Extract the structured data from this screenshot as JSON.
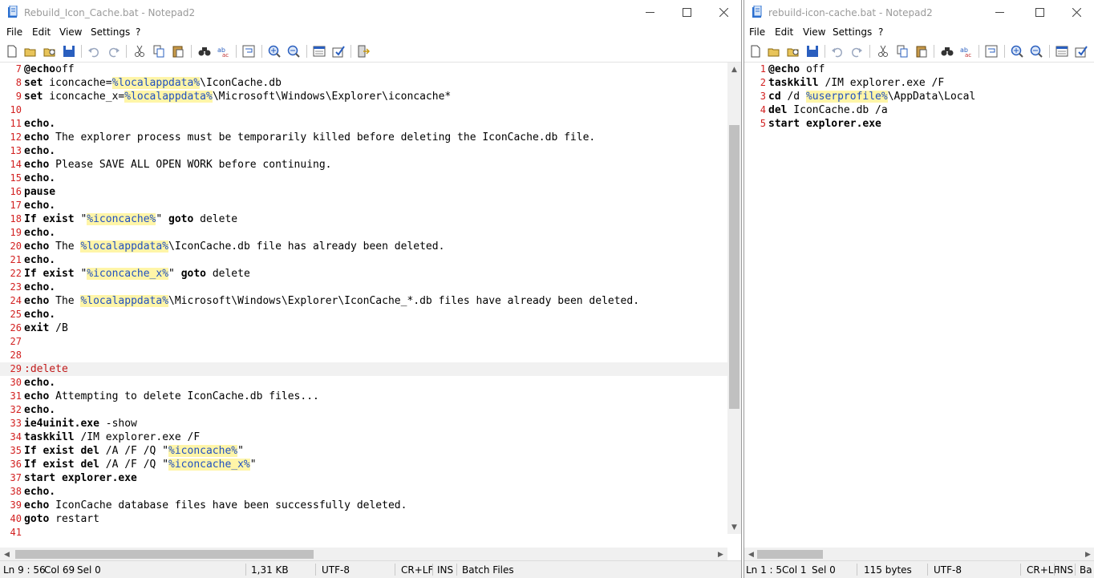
{
  "left": {
    "title": "Rebuild_Icon_Cache.bat - Notepad2",
    "menu": [
      "File",
      "Edit",
      "View",
      "Settings",
      "?"
    ],
    "lines": [
      {
        "n": "7",
        "seg": [
          [
            "kw",
            "@echo"
          ],
          [
            "",
            "off"
          ]
        ]
      },
      {
        "n": "8",
        "seg": [
          [
            "kw",
            "set"
          ],
          [
            "",
            " iconcache="
          ],
          [
            "var",
            "%localappdata%"
          ],
          [
            "",
            "\\IconCache.db"
          ]
        ]
      },
      {
        "n": "9",
        "seg": [
          [
            "kw",
            "set"
          ],
          [
            "",
            " iconcache_x="
          ],
          [
            "var",
            "%localappdata%"
          ],
          [
            "",
            "\\Microsoft\\Windows\\Explorer\\iconcache*"
          ]
        ]
      },
      {
        "n": "10",
        "seg": []
      },
      {
        "n": "11",
        "seg": [
          [
            "kw",
            "echo."
          ]
        ]
      },
      {
        "n": "12",
        "seg": [
          [
            "kw",
            "echo"
          ],
          [
            "",
            " The explorer process must be temporarily killed before deleting the IconCache.db file."
          ]
        ]
      },
      {
        "n": "13",
        "seg": [
          [
            "kw",
            "echo."
          ]
        ]
      },
      {
        "n": "14",
        "seg": [
          [
            "kw",
            "echo"
          ],
          [
            "",
            " Please SAVE ALL OPEN WORK before continuing."
          ]
        ]
      },
      {
        "n": "15",
        "seg": [
          [
            "kw",
            "echo."
          ]
        ]
      },
      {
        "n": "16",
        "seg": [
          [
            "kw",
            "pause"
          ]
        ]
      },
      {
        "n": "17",
        "seg": [
          [
            "kw",
            "echo."
          ]
        ]
      },
      {
        "n": "18",
        "seg": [
          [
            "kw",
            "If exist"
          ],
          [
            "",
            " \""
          ],
          [
            "var",
            "%iconcache%"
          ],
          [
            "",
            "\" "
          ],
          [
            "kw",
            "goto"
          ],
          [
            "",
            " delete"
          ]
        ]
      },
      {
        "n": "19",
        "seg": [
          [
            "kw",
            "echo."
          ]
        ]
      },
      {
        "n": "20",
        "seg": [
          [
            "kw",
            "echo"
          ],
          [
            "",
            " The "
          ],
          [
            "var",
            "%localappdata%"
          ],
          [
            "",
            "\\IconCache.db file has already been deleted."
          ]
        ]
      },
      {
        "n": "21",
        "seg": [
          [
            "kw",
            "echo."
          ]
        ]
      },
      {
        "n": "22",
        "seg": [
          [
            "kw",
            "If exist"
          ],
          [
            "",
            " \""
          ],
          [
            "var",
            "%iconcache_x%"
          ],
          [
            "",
            "\" "
          ],
          [
            "kw",
            "goto"
          ],
          [
            "",
            " delete"
          ]
        ]
      },
      {
        "n": "23",
        "seg": [
          [
            "kw",
            "echo."
          ]
        ]
      },
      {
        "n": "24",
        "seg": [
          [
            "kw",
            "echo"
          ],
          [
            "",
            " The "
          ],
          [
            "var",
            "%localappdata%"
          ],
          [
            "",
            "\\Microsoft\\Windows\\Explorer\\IconCache_*.db files have already been deleted."
          ]
        ]
      },
      {
        "n": "25",
        "seg": [
          [
            "kw",
            "echo."
          ]
        ]
      },
      {
        "n": "26",
        "seg": [
          [
            "kw",
            "exit"
          ],
          [
            "",
            " /B"
          ]
        ]
      },
      {
        "n": "27",
        "seg": []
      },
      {
        "n": "28",
        "seg": []
      },
      {
        "n": "29",
        "seg": [
          [
            "label",
            ":delete"
          ]
        ],
        "current": true
      },
      {
        "n": "30",
        "seg": [
          [
            "kw",
            "echo."
          ]
        ]
      },
      {
        "n": "31",
        "seg": [
          [
            "kw",
            "echo"
          ],
          [
            "",
            " Attempting to delete IconCache.db files..."
          ]
        ]
      },
      {
        "n": "32",
        "seg": [
          [
            "kw",
            "echo."
          ]
        ]
      },
      {
        "n": "33",
        "seg": [
          [
            "kw",
            "ie4uinit.exe"
          ],
          [
            "",
            " -show"
          ]
        ]
      },
      {
        "n": "34",
        "seg": [
          [
            "kw",
            "taskkill"
          ],
          [
            "",
            " /IM explorer.exe /F"
          ]
        ]
      },
      {
        "n": "35",
        "seg": [
          [
            "kw",
            "If exist del"
          ],
          [
            "",
            " /A /F /Q \""
          ],
          [
            "var",
            "%iconcache%"
          ],
          [
            "",
            "\""
          ]
        ]
      },
      {
        "n": "36",
        "seg": [
          [
            "kw",
            "If exist del"
          ],
          [
            "",
            " /A /F /Q \""
          ],
          [
            "var",
            "%iconcache_x%"
          ],
          [
            "",
            "\""
          ]
        ]
      },
      {
        "n": "37",
        "seg": [
          [
            "kw",
            "start explorer.exe"
          ]
        ]
      },
      {
        "n": "38",
        "seg": [
          [
            "kw",
            "echo."
          ]
        ]
      },
      {
        "n": "39",
        "seg": [
          [
            "kw",
            "echo"
          ],
          [
            "",
            " IconCache database files have been successfully deleted."
          ]
        ]
      },
      {
        "n": "40",
        "seg": [
          [
            "kw",
            "goto"
          ],
          [
            "",
            " restart"
          ]
        ]
      },
      {
        "n": "41",
        "seg": []
      }
    ],
    "status": {
      "position": "Ln 9 : 56",
      "col": "Col 69",
      "sel": "Sel 0",
      "size": "1,31 KB",
      "encoding": "UTF-8",
      "eol": "CR+LF",
      "mode": "INS",
      "lexer": "Batch Files"
    }
  },
  "right": {
    "title": "rebuild-icon-cache.bat - Notepad2",
    "menu": [
      "File",
      "Edit",
      "View",
      "Settings",
      "?"
    ],
    "lines": [
      {
        "n": "1",
        "seg": [
          [
            "kw",
            "@echo"
          ],
          [
            "",
            " off"
          ]
        ]
      },
      {
        "n": "2",
        "seg": [
          [
            "kw",
            "taskkill"
          ],
          [
            "",
            " /IM explorer.exe /F"
          ]
        ]
      },
      {
        "n": "3",
        "seg": [
          [
            "kw",
            "cd"
          ],
          [
            "",
            " /d "
          ],
          [
            "var",
            "%userprofile%"
          ],
          [
            "",
            "\\AppData\\Local"
          ]
        ]
      },
      {
        "n": "4",
        "seg": [
          [
            "kw",
            "del"
          ],
          [
            "",
            " IconCache.db /a"
          ]
        ]
      },
      {
        "n": "5",
        "seg": [
          [
            "kw",
            "start explorer.exe"
          ]
        ]
      }
    ],
    "status": {
      "position": "Ln 1 : 5",
      "col": "Col 1",
      "sel": "Sel 0",
      "size": "115 bytes",
      "encoding": "UTF-8",
      "eol": "CR+LF",
      "mode": "INS",
      "lexer": "Ba"
    }
  },
  "colors": {
    "line_number": "#d22020",
    "variable_highlight": "#fff5a8",
    "variable_text": "#2050c0",
    "label": "#c01a1a"
  },
  "icons": [
    "new-file-icon",
    "open-icon",
    "browse-icon",
    "save-icon",
    "undo-icon",
    "redo-icon",
    "cut-icon",
    "copy-icon",
    "paste-icon",
    "find-icon",
    "replace-icon",
    "word-wrap-icon",
    "zoom-in-icon",
    "zoom-out-icon",
    "scheme-icon",
    "customize-icon",
    "exit-icon"
  ]
}
